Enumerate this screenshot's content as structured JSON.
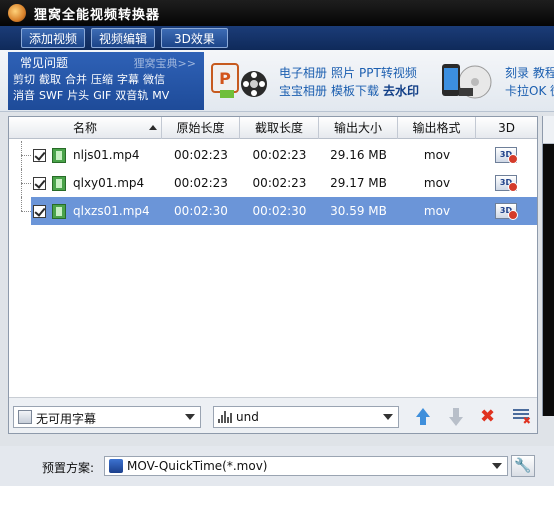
{
  "window": {
    "title": "狸窝全能视频转换器"
  },
  "toolbar": {
    "add_video": "添加视频",
    "edit_video": "视频编辑",
    "effect_3d": "3D效果"
  },
  "faq": {
    "title": "常见问题",
    "more": "狸窝宝典>>",
    "links": [
      "剪切",
      "截取",
      "合并",
      "压缩",
      "字幕",
      "微信",
      "消音",
      "SWF",
      "片头",
      "GIF",
      "双音轨",
      "MV"
    ]
  },
  "promo1": {
    "line1": [
      "电子相册",
      "照片",
      "PPT转视频"
    ],
    "line2": [
      "宝宝相册",
      "模板下载"
    ],
    "line2_bold": "去水印"
  },
  "promo2": {
    "line1": "刻录 教程",
    "line2": "卡拉OK 微"
  },
  "table": {
    "headers": [
      "名称",
      "原始长度",
      "截取长度",
      "输出大小",
      "输出格式",
      "3D"
    ],
    "rows": [
      {
        "name": "nljs01.mp4",
        "original": "00:02:23",
        "clip": "00:02:23",
        "size": "29.16 MB",
        "format": "mov",
        "selected": false
      },
      {
        "name": "qlxy01.mp4",
        "original": "00:02:23",
        "clip": "00:02:23",
        "size": "29.17 MB",
        "format": "mov",
        "selected": false
      },
      {
        "name": "qlxzs01.mp4",
        "original": "00:02:30",
        "clip": "00:02:30",
        "size": "30.59 MB",
        "format": "mov",
        "selected": true
      }
    ],
    "icon_3d": "3D"
  },
  "footer": {
    "subtitle_value": "无可用字幕",
    "audio_value": "und"
  },
  "preset": {
    "label": "预置方案:",
    "value": "MOV-QuickTime(*.mov)"
  },
  "colors": {
    "selected_row": "#6b95d8",
    "toolbar": "#1b3c78",
    "faq_panel": "#2f62b7"
  }
}
